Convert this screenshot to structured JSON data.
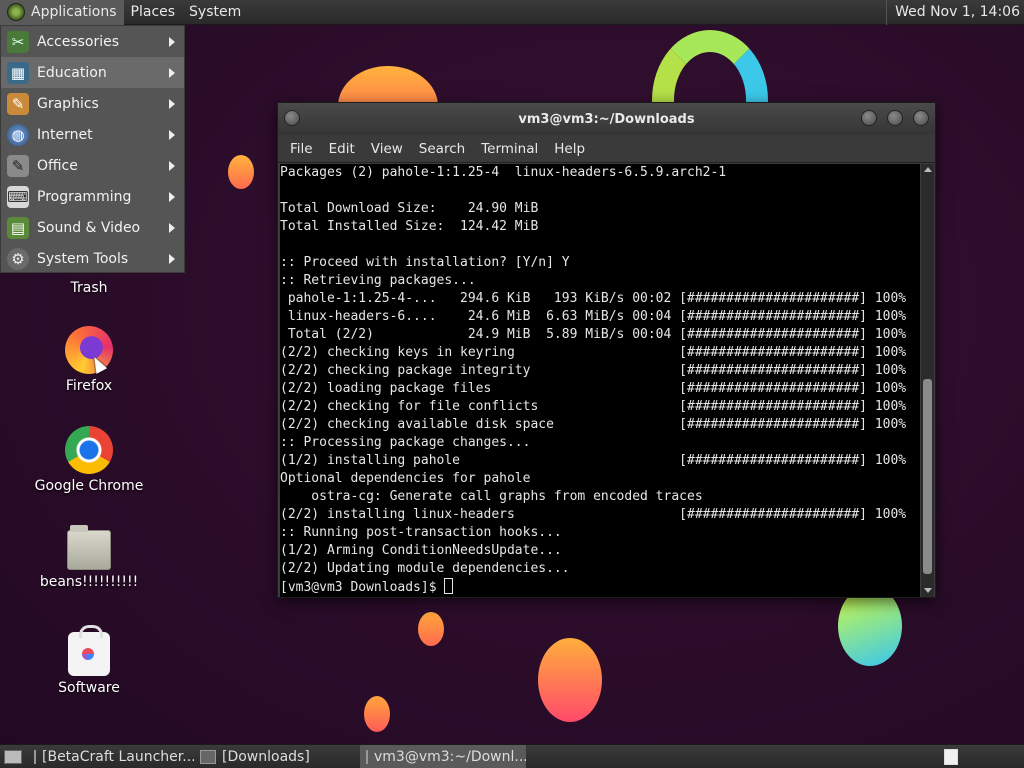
{
  "top_panel": {
    "menus": [
      "Applications",
      "Places",
      "System"
    ],
    "clock": "Wed Nov 1, 14:06"
  },
  "apps_menu": {
    "items": [
      {
        "label": "Accessories",
        "icon": "accessories-icon"
      },
      {
        "label": "Education",
        "icon": "education-icon"
      },
      {
        "label": "Graphics",
        "icon": "graphics-icon"
      },
      {
        "label": "Internet",
        "icon": "internet-icon"
      },
      {
        "label": "Office",
        "icon": "office-icon"
      },
      {
        "label": "Programming",
        "icon": "programming-icon"
      },
      {
        "label": "Sound & Video",
        "icon": "sound-video-icon"
      },
      {
        "label": "System Tools",
        "icon": "system-tools-icon"
      }
    ]
  },
  "desktop": {
    "icons": [
      {
        "label": "Trash",
        "icon": "trash-icon"
      },
      {
        "label": "Firefox",
        "icon": "firefox-icon"
      },
      {
        "label": "Google Chrome",
        "icon": "chrome-icon"
      },
      {
        "label": "beans!!!!!!!!!!",
        "icon": "folder-icon"
      },
      {
        "label": "Software",
        "icon": "software-icon"
      }
    ]
  },
  "terminal": {
    "title": "vm3@vm3:~/Downloads",
    "menu": [
      "File",
      "Edit",
      "View",
      "Search",
      "Terminal",
      "Help"
    ],
    "lines": [
      "Packages (2) pahole-1:1.25-4  linux-headers-6.5.9.arch2-1",
      "",
      "Total Download Size:    24.90 MiB",
      "Total Installed Size:  124.42 MiB",
      "",
      ":: Proceed with installation? [Y/n] Y",
      ":: Retrieving packages...",
      " pahole-1:1.25-4-...   294.6 KiB   193 KiB/s 00:02 [######################] 100%",
      " linux-headers-6....    24.6 MiB  6.63 MiB/s 00:04 [######################] 100%",
      " Total (2/2)            24.9 MiB  5.89 MiB/s 00:04 [######################] 100%",
      "(2/2) checking keys in keyring                     [######################] 100%",
      "(2/2) checking package integrity                   [######################] 100%",
      "(2/2) loading package files                        [######################] 100%",
      "(2/2) checking for file conflicts                  [######################] 100%",
      "(2/2) checking available disk space                [######################] 100%",
      ":: Processing package changes...",
      "(1/2) installing pahole                            [######################] 100%",
      "Optional dependencies for pahole",
      "    ostra-cg: Generate call graphs from encoded traces",
      "(2/2) installing linux-headers                     [######################] 100%",
      ":: Running post-transaction hooks...",
      "(1/2) Arming ConditionNeedsUpdate...",
      "(2/2) Updating module dependencies..."
    ],
    "prompt": "[vm3@vm3 Downloads]$ "
  },
  "taskbar": {
    "tasks": [
      {
        "label": "[BetaCraft Launcher...",
        "active": false
      },
      {
        "label": "[Downloads]",
        "active": false
      },
      {
        "label": "vm3@vm3:~/Downl...",
        "active": true
      }
    ]
  }
}
